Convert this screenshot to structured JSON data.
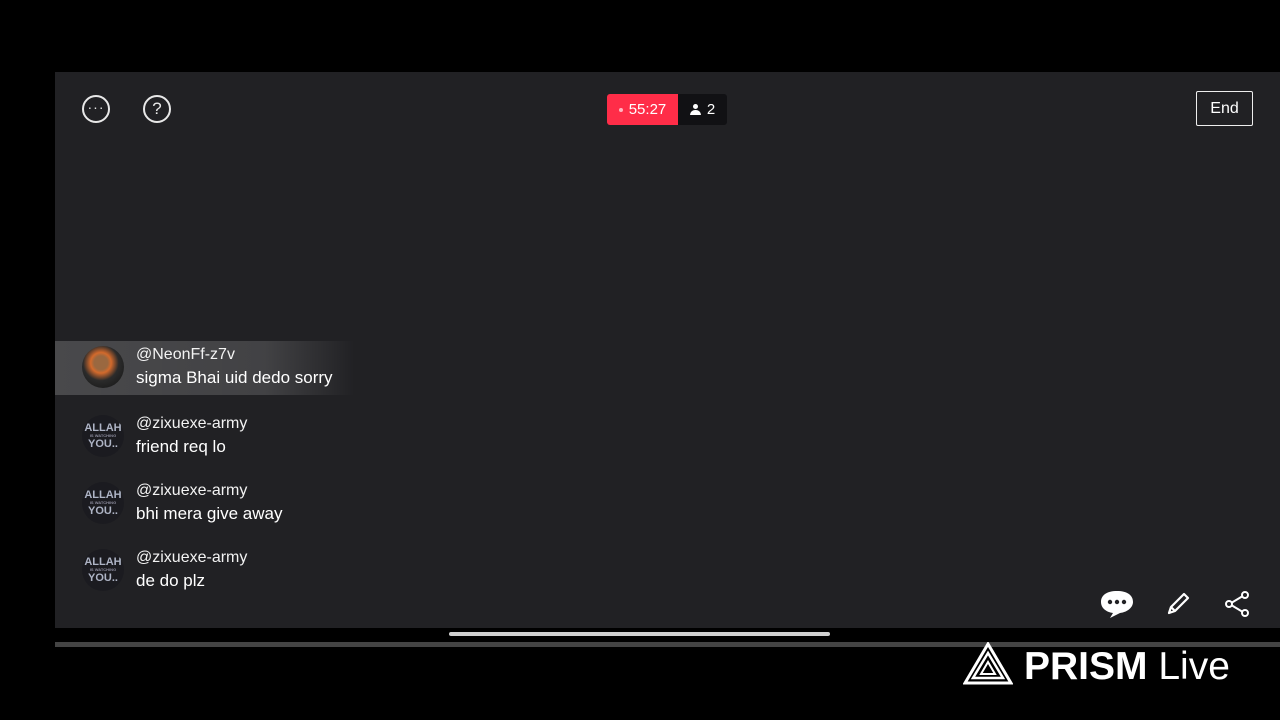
{
  "top_bar": {
    "more_icon": "ellipsis-circle-icon",
    "help_icon": "question-circle-icon",
    "timer": "55:27",
    "viewer_count": "2",
    "end_label": "End"
  },
  "comments": [
    {
      "username": "@NeonFf-z7v",
      "message": "sigma Bhai uid dedo sorry"
    },
    {
      "username": "@zixuexe-army",
      "message": "friend req lo"
    },
    {
      "username": "@zixuexe-army",
      "message": "bhi mera give away"
    },
    {
      "username": "@zixuexe-army",
      "message": "de do plz"
    }
  ],
  "avatar_text": {
    "line1": "ALLAH",
    "line3": "YOU..",
    "line2": "IS WATCHING"
  },
  "bottom_actions": {
    "chat_icon": "chat-bubble-icon",
    "edit_icon": "pencil-icon",
    "share_icon": "share-icon"
  },
  "watermark": {
    "brand": "PRISM",
    "suffix": "Live"
  },
  "colors": {
    "live_red": "#ff2d48",
    "screen_bg": "#212124",
    "outer_bg": "#000000"
  }
}
